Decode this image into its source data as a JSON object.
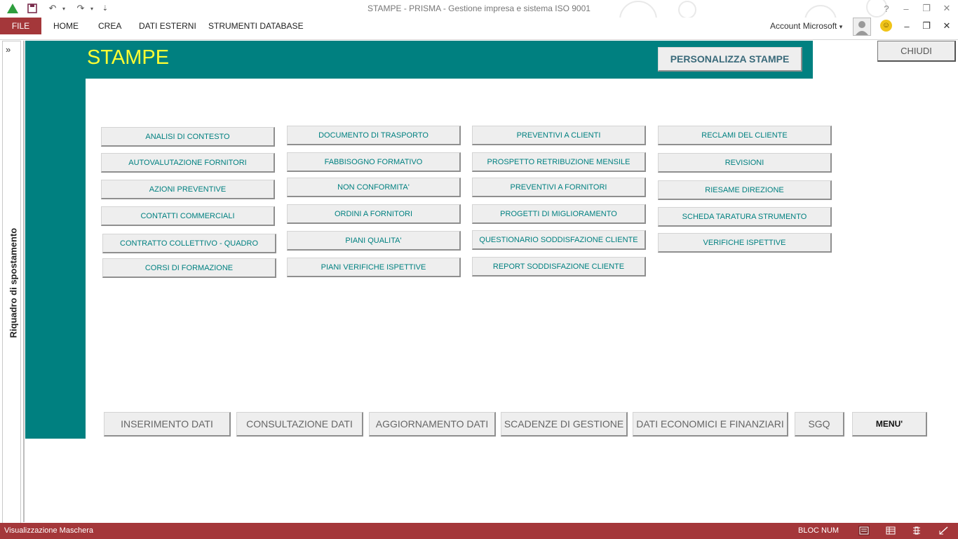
{
  "window": {
    "title": "STAMPE - PRISMA - Gestione impresa e sistema ISO 9001",
    "help": "?",
    "minimize": "–",
    "restore": "❐",
    "close": "✕"
  },
  "ribbon": {
    "tabs": [
      "FILE",
      "HOME",
      "CREA",
      "DATI ESTERNI",
      "STRUMENTI DATABASE"
    ],
    "account": "Account Microsoft",
    "account_arrow": "▾"
  },
  "nav_pane": {
    "toggle": "»",
    "label": "Riquadro di spostamento"
  },
  "form": {
    "title": "STAMPE",
    "customize_button": "PERSONALIZZA STAMPE",
    "close_button": "CHIUDI",
    "report_buttons": {
      "col1": [
        "ANALISI DI CONTESTO",
        "AUTOVALUTAZIONE FORNITORI",
        "AZIONI PREVENTIVE",
        "CONTATTI COMMERCIALI",
        "CONTRATTO COLLETTIVO - QUADRO",
        "CORSI DI FORMAZIONE"
      ],
      "col2": [
        "DOCUMENTO DI TRASPORTO",
        "FABBISOGNO FORMATIVO",
        "NON CONFORMITA'",
        "ORDINI A FORNITORI",
        "PIANI QUALITA'",
        "PIANI VERIFICHE ISPETTIVE"
      ],
      "col3": [
        "PREVENTIVI A CLIENTI",
        "PROSPETTO RETRIBUZIONE MENSILE",
        "PREVENTIVI A FORNITORI",
        "PROGETTI DI MIGLIORAMENTO",
        "QUESTIONARIO SODDISFAZIONE CLIENTE",
        "REPORT SODDISFAZIONE CLIENTE"
      ],
      "col4": [
        "RECLAMI DEL CLIENTE",
        "REVISIONI",
        "RIESAME DIREZIONE",
        "SCHEDA TARATURA STRUMENTO",
        "VERIFICHE ISPETTIVE"
      ]
    },
    "bottom_nav": [
      "INSERIMENTO DATI",
      "CONSULTAZIONE DATI",
      "AGGIORNAMENTO DATI",
      "SCADENZE DI GESTIONE",
      "DATI ECONOMICI E FINANZIARI",
      "SGQ",
      "MENU'"
    ]
  },
  "status_bar": {
    "left": "Visualizzazione Maschera",
    "right": "BLOC NUM"
  },
  "colors": {
    "teal": "#008080",
    "title_yellow": "#ffff33",
    "status_red": "#a4373a"
  }
}
